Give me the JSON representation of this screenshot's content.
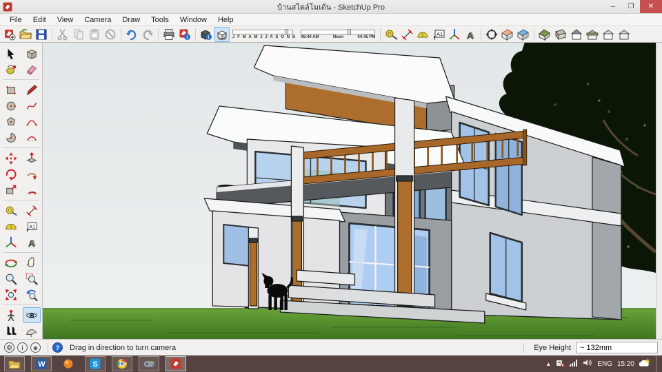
{
  "window": {
    "title": "บ้านสไตล์โมเด้น - SketchUp Pro",
    "controls": {
      "minimize": "–",
      "restore": "❐",
      "close": "✕"
    }
  },
  "menu": {
    "items": [
      "File",
      "Edit",
      "View",
      "Camera",
      "Draw",
      "Tools",
      "Window",
      "Help"
    ]
  },
  "shadows": {
    "months": "J F M A M J J A S O N D",
    "time_start": "06:44 AM",
    "time_noon": "Noon",
    "time_end": "04:45 PM"
  },
  "statusbar": {
    "hint": "Drag in direction to turn camera",
    "eye_height_label": "Eye Height",
    "eye_height_value": "~ 132mm",
    "help_glyph": "?",
    "info_glyph": "i"
  },
  "taskbar": {
    "language": "ENG",
    "clock": "15:20"
  },
  "colors": {
    "selection_highlight": "#cfe4f7",
    "taskbar_bg": "#564341",
    "grass": "#5e9632",
    "sky": "#e8ecee",
    "wood_accent": "#ad6e2d",
    "window_glass": "#a9c9ec",
    "close_button": "#c75050"
  },
  "icons": {
    "toolbar": [
      "new",
      "open",
      "save",
      "cut",
      "copy",
      "paste",
      "erase",
      "undo",
      "redo",
      "print",
      "model-info",
      "entity-info",
      "shadows-toggle",
      "tape-measure",
      "dimension",
      "protractor",
      "text",
      "axes",
      "3d-text",
      "camera-target",
      "section-plane",
      "section-cuts",
      "view-iso",
      "view-top",
      "view-front",
      "view-back",
      "view-left",
      "view-right"
    ],
    "palette": [
      "select",
      "make-component",
      "paint-bucket",
      "eraser",
      "rectangle",
      "line",
      "circle",
      "freehand",
      "polygon",
      "arc",
      "pie",
      "arc-2pt",
      "move",
      "push-pull",
      "rotate",
      "follow-me",
      "scale",
      "offset",
      "tape-measure",
      "dimension",
      "protractor",
      "text",
      "axes",
      "3d-text",
      "orbit",
      "pan",
      "zoom",
      "zoom-window",
      "zoom-extents",
      "zoom-previous",
      "position-camera",
      "look-around",
      "walk",
      "section-plane"
    ],
    "active_tool": "look-around"
  }
}
